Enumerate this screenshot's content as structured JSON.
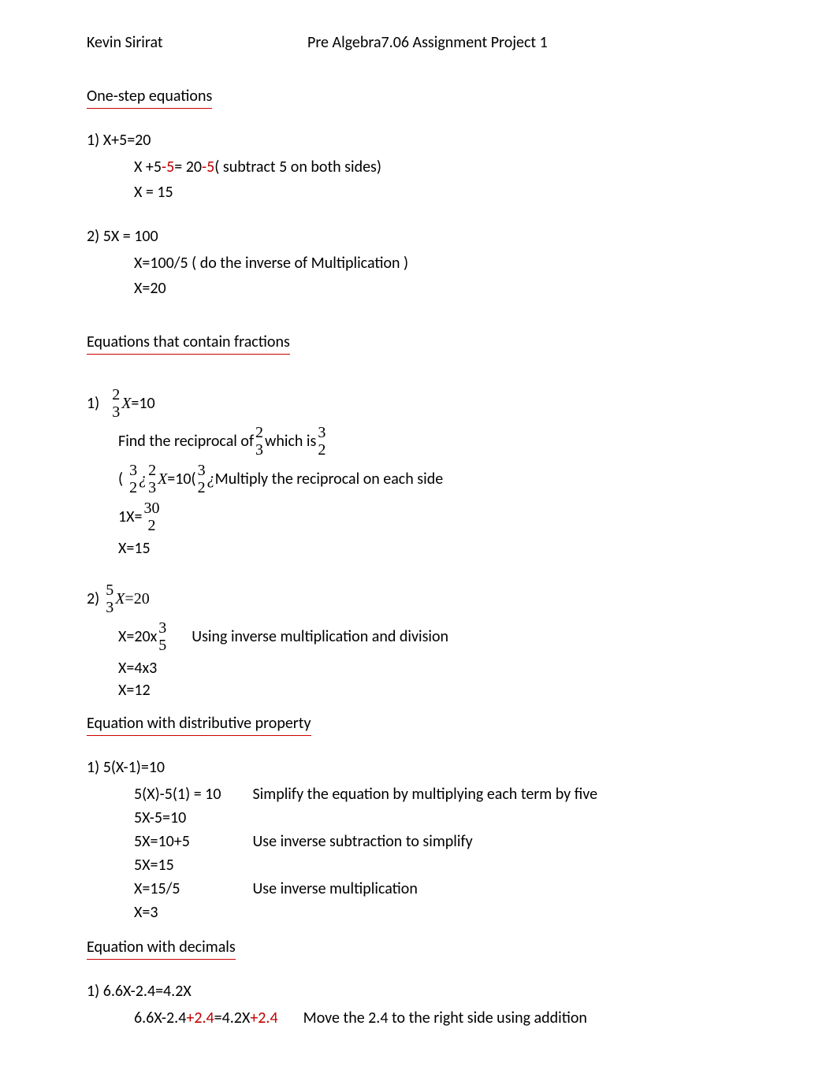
{
  "header": {
    "student": "Kevin Sirirat",
    "course": "Pre Algebra7.06 Assignment Project 1"
  },
  "s1": {
    "heading": "One-step equations",
    "p1": {
      "label": " 1) X+5=20",
      "step1a": "X +5 ",
      "step1b": "-5",
      "step1c": " = 20 ",
      "step1d": "-5",
      "step1e": "  ( subtract 5 on both sides)",
      "step2": "X = 15"
    },
    "p2": {
      "label": "2) 5X = 100",
      "step1": "X=100/5    ( do the inverse of Multiplication )",
      "step2": "X=20"
    }
  },
  "s2": {
    "heading": "Equations that contain fractions",
    "p1": {
      "label": "1)",
      "f1n": "2",
      "f1d": "3",
      "eq1a": "X",
      "eq1b": "  =10",
      "findA": "Find the reciprocal of  ",
      "f2n": "2",
      "f2d": "3",
      "findB": "  which is  ",
      "f3n": "3",
      "f3d": "2",
      "lp": "(",
      "f4n": "3",
      "f4d": "2",
      "qm": "¿",
      "f5n": "2",
      "f5d": "3",
      "mid1": "X",
      "mid2": "  =10(  ",
      "f6n": "3",
      "f6d": "2",
      "multtxt": "  Multiply the reciprocal on each side",
      "onex": "1X=  ",
      "f7n": "30",
      "f7d": "2",
      "x15": "X=15"
    },
    "p2": {
      "label": "2)",
      "f1n": "5",
      "f1d": "3",
      "eq": "X",
      "eqb": "=",
      "eqc": "20",
      "x20": "X=20x  ",
      "f2n": "3",
      "f2d": "5",
      "usetxt": "Using inverse multiplication and division",
      "x4x3": "X=4x3",
      "x12": "X=12"
    }
  },
  "s3": {
    "heading": "Equation with distributive property",
    "p1": {
      "label": "1) 5(X-1)=10",
      "r1a": "5(X)-5(1) = 10",
      "r1b": "Simplify the equation by multiplying each term by five",
      "r2a": "5X-5=10",
      "r3a": "5X=10+5",
      "r3b": "Use inverse subtraction to simplify",
      "r4a": "5X=15",
      "r5a": "X=15/5",
      "r5b": "Use inverse multiplication",
      "r6a": "X=3"
    }
  },
  "s4": {
    "heading": "Equation with decimals",
    "p1": {
      "label": "1) 6.6X-2.4=4.2X",
      "a": "6.6X-2.4",
      "b": "+2.4",
      "c": "=4.2X",
      "d": "+2.4",
      "e": "Move the 2.4 to the right side using addition"
    }
  }
}
